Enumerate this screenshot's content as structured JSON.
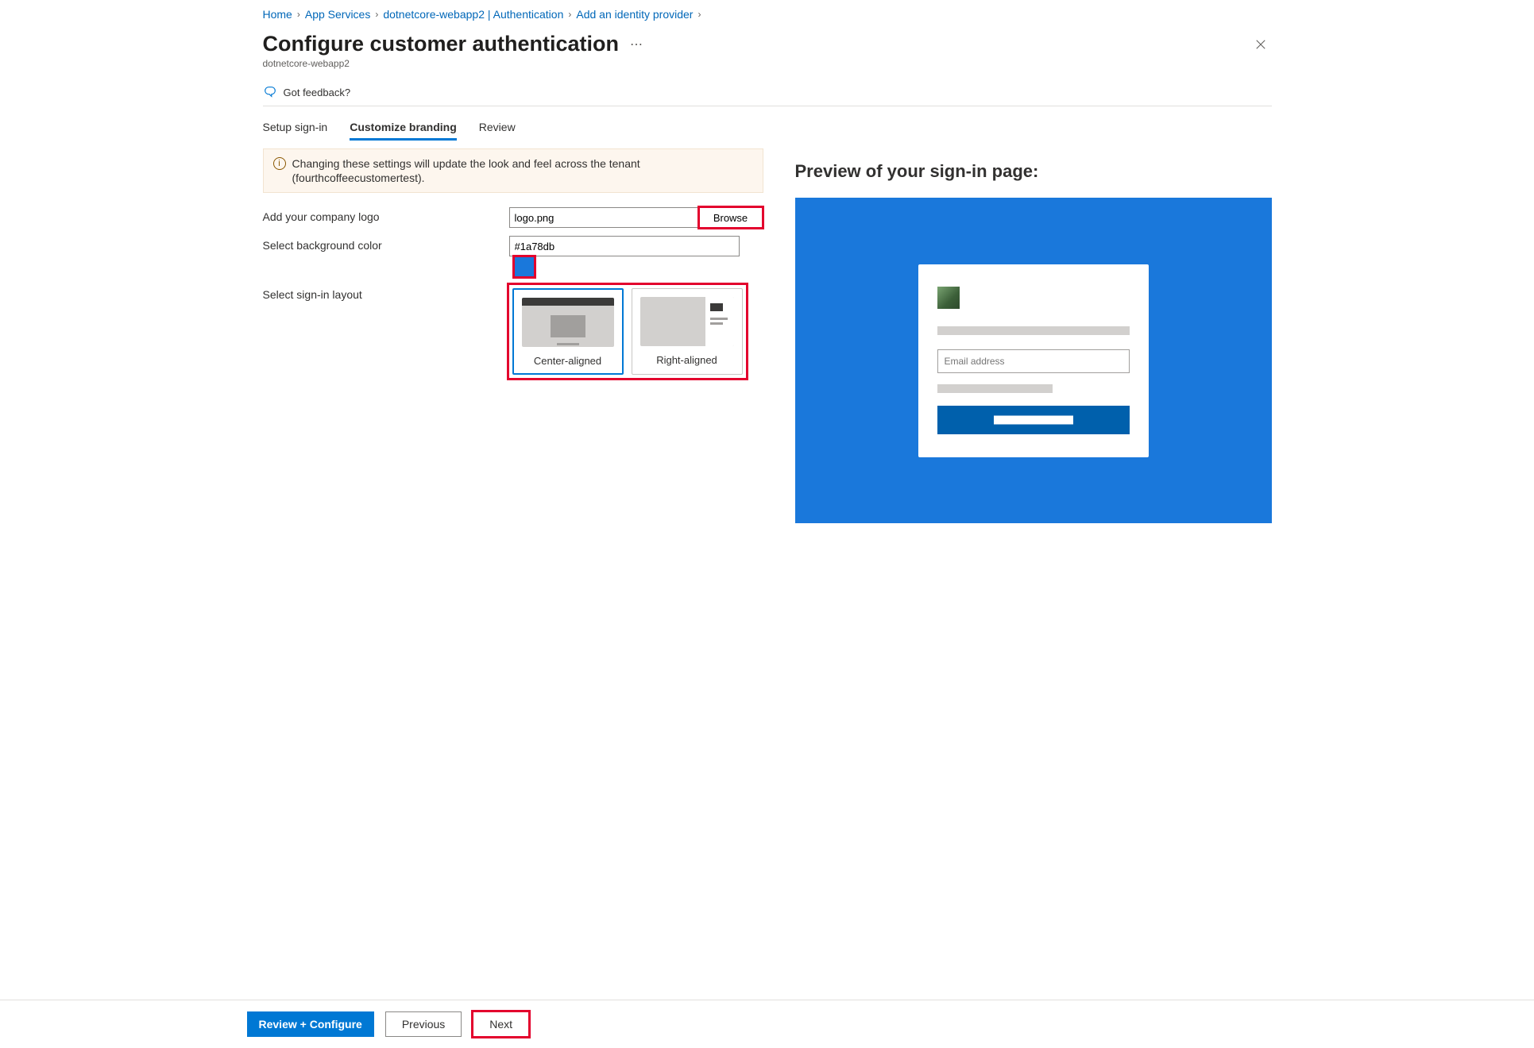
{
  "breadcrumb": [
    {
      "label": "Home"
    },
    {
      "label": "App Services"
    },
    {
      "label": "dotnetcore-webapp2 | Authentication"
    },
    {
      "label": "Add an identity provider"
    }
  ],
  "header": {
    "title": "Configure customer authentication",
    "subtitle": "dotnetcore-webapp2"
  },
  "feedback_label": "Got feedback?",
  "tabs": [
    {
      "label": "Setup sign-in",
      "active": false
    },
    {
      "label": "Customize branding",
      "active": true
    },
    {
      "label": "Review",
      "active": false
    }
  ],
  "info_text": "Changing these settings will update the look and feel across the tenant (fourthcoffeecustomertest).",
  "form": {
    "logo_label": "Add your company logo",
    "logo_value": "logo.png",
    "browse_label": "Browse",
    "bgcolor_label": "Select background color",
    "bgcolor_value": "#1a78db",
    "layout_label": "Select sign-in layout",
    "layout_options": [
      {
        "label": "Center-aligned",
        "selected": true
      },
      {
        "label": "Right-aligned",
        "selected": false
      }
    ]
  },
  "preview": {
    "title": "Preview of your sign-in page:",
    "email_placeholder": "Email address"
  },
  "footer": {
    "primary": "Review + Configure",
    "previous": "Previous",
    "next": "Next"
  }
}
